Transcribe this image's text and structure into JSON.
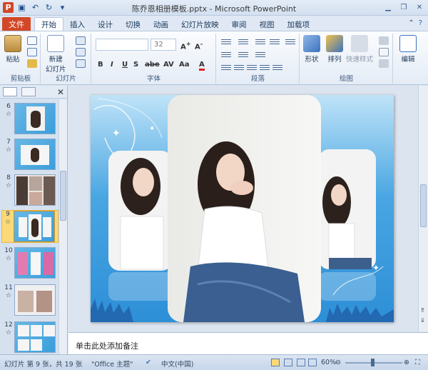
{
  "window": {
    "title": "陈乔恩相册模板.pptx - Microsoft PowerPoint"
  },
  "ribbon_tabs": {
    "file": "文件",
    "items": [
      "开始",
      "插入",
      "设计",
      "切换",
      "动画",
      "幻灯片放映",
      "审阅",
      "视图",
      "加载项"
    ],
    "active": "开始"
  },
  "groups": {
    "clipboard": {
      "label": "剪贴板",
      "paste": "粘贴"
    },
    "slides": {
      "label": "幻灯片",
      "new_slide": "新建\n幻灯片"
    },
    "font": {
      "label": "字体",
      "font_size": "32"
    },
    "paragraph": {
      "label": "段落"
    },
    "drawing": {
      "label": "绘图",
      "shapes": "形状",
      "arrange": "排列",
      "quick_styles": "快速样式"
    },
    "editing": {
      "label": "编辑"
    }
  },
  "thumbnails": [
    {
      "num": "6"
    },
    {
      "num": "7"
    },
    {
      "num": "8"
    },
    {
      "num": "9",
      "selected": true
    },
    {
      "num": "10"
    },
    {
      "num": "11"
    },
    {
      "num": "12"
    }
  ],
  "thumb_sub": "☆",
  "notes": {
    "placeholder": "单击此处添加备注"
  },
  "status": {
    "slide_info": "幻灯片 第 9 张，共 19 张",
    "theme": "\"Office 主题\"",
    "language": "中文(中国)",
    "zoom": "60%"
  },
  "colors": {
    "file_tab": "#d24726",
    "accent": "#2d8fd7",
    "selected_thumb": "#fbd977"
  }
}
